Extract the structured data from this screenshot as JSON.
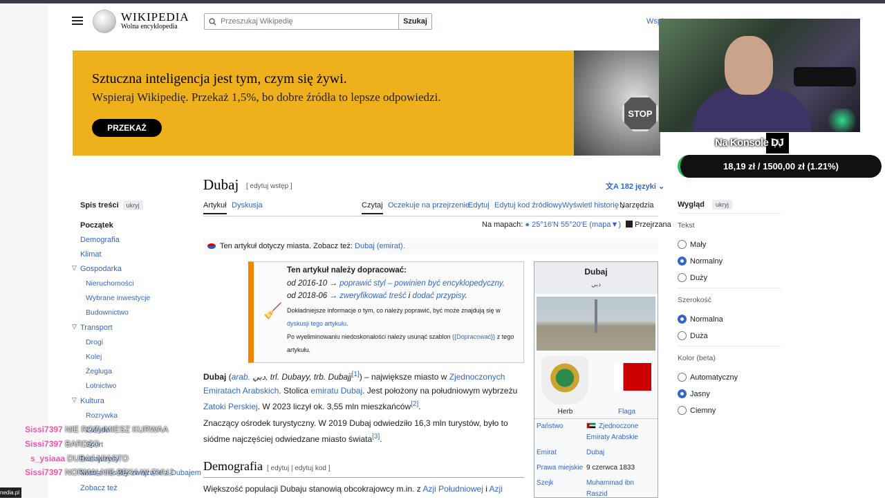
{
  "header": {
    "logo_word": "WIKIPEDIA",
    "logo_tagline": "Wolna encyklopedia",
    "search_placeholder": "Przeszukaj Wikipedię",
    "search_button": "Szukaj",
    "support_link": "Wspi"
  },
  "banner": {
    "headline": "Sztuczna inteligencja jest tym, czym się żywi.",
    "text": "Wspieraj Wikipedię. Przekaż 1,5%, bo dobre źródła to lepsze odpowiedzi.",
    "donate_button": "PRZEKAŻ",
    "stop_sign": "STOP"
  },
  "stream": {
    "channel": "Na Konsole DJ",
    "w_logo": "W",
    "donation_bar": "18,19 zł  /  1500,00 zł (1.21%)"
  },
  "article": {
    "title": "Dubaj",
    "edit_intro": "[ edytuj wstęp ]",
    "languages": "182 języki",
    "tabs": {
      "article": "Artykuł",
      "talk": "Dyskusja",
      "read": "Czytaj",
      "pending": "Oczekuje na przejrzenie",
      "edit": "Edytuj",
      "edit_source": "Edytuj kod źródłowy",
      "history": "Wyświetl historię",
      "tools": "Narzędzia"
    },
    "coords": {
      "prefix": "Na mapach:",
      "value": "25°16′N 55°20′E",
      "map_link": "(mapa▼)",
      "reviewed": "Przejrzana"
    },
    "hatnote": {
      "text": "Ten artykuł dotyczy miasta. Zobacz też: ",
      "link": "Dubaj (emirat)."
    },
    "ambox": {
      "heading": "Ten artykuł należy dopracować:",
      "line1_date": "od 2016-10 → ",
      "line1_link": "poprawić styl – powinien być encyklopedyczny,",
      "line2_date": "od 2018-06 → ",
      "line2_link": "zweryfikować treść",
      "line2_and": " i ",
      "line2_link2": "dodać przypisy",
      "line2_end": ".",
      "small1": "Dokładniejsze informacje o tym, co należy poprawić, być może znajdują się w ",
      "small1_link": "dyskusji tego artykułu",
      "small1_end": ".",
      "small2": "Po wyeliminowaniu niedoskonałości należy usunąć szablon ",
      "small2_code": "{{Dopracować}}",
      "small2_end": " z tego artykułu."
    },
    "para1": {
      "b": "Dubaj",
      "p1": " (",
      "arab": "arab. ",
      "arabic": "دبي",
      "trl": ", trl. Dubayy, trb. Dubajj",
      "ref1": "[1]",
      "p2": ") – największe miasto w ",
      "link1": "Zjednoczonych Emiratach Arabskich",
      "p3": ". Stolica ",
      "link2": "emiratu Dubaj",
      "p4": ". Jest położony na południowym wybrzeżu ",
      "link3": "Zatoki Perskiej",
      "p5": ". W 2023 liczył ok. 3,55 mln mieszkańców",
      "ref2": "[2]",
      "p6": "."
    },
    "para2": {
      "text": "Znaczący ośrodek turystyczny. W 2019 Dubaj odwiedziło 16,3 mln turystów, było to siódme najczęściej odwiedzane miasto świata",
      "ref": "[3]",
      "end": "."
    },
    "section": {
      "title": "Demografia",
      "edit": "[ edytuj | edytuj kod ]"
    },
    "para3": {
      "p1": "Większość populacji Dubaju stanowią obcokrajowcy m.in. z ",
      "link1": "Azji Południowej",
      "p2": " i ",
      "link2": "Azji"
    }
  },
  "infobox": {
    "title": "Dubaj",
    "arabic": "دبي",
    "coat_caption": "Herb",
    "flag_caption": "Flaga",
    "rows": [
      {
        "k": "Państwo",
        "v": "Zjednoczone Emiraty Arabskie"
      },
      {
        "k": "Emirat",
        "v": "Dubaj"
      },
      {
        "k": "Prawa miejskie",
        "v": "9 czerwca 1833"
      },
      {
        "k": "Szejk",
        "v": "Muhammad ibn Raszid"
      }
    ]
  },
  "toc": {
    "heading": "Spis treści",
    "hide": "ukryj",
    "items": [
      "Początek",
      "Demografia",
      "Klimat",
      "Gospodarka",
      "Nieruchomości",
      "Wybrane inwestycje",
      "Budownictwo",
      "Transport",
      "Drogi",
      "Kolej",
      "Żegluga",
      "Lotnictwo",
      "Kultura",
      "Rozrywka",
      "Zobacz też"
    ],
    "partial": [
      "Zabytki",
      "Sport",
      "Dubajczycy",
      "Dubaj nocą",
      "Miasta i osoby związane z Dubajem"
    ]
  },
  "appearance": {
    "heading": "Wygląd",
    "hide": "ukryj",
    "text_label": "Tekst",
    "text_opts": [
      "Mały",
      "Normalny",
      "Duży"
    ],
    "width_label": "Szerokość",
    "width_opts": [
      "Normalna",
      "Duża"
    ],
    "color_label": "Kolor (beta)",
    "color_opts": [
      "Automatyczny",
      "Jasny",
      "Ciemny"
    ]
  },
  "chat": [
    {
      "user": "Sissi7397",
      "msg": "NIE ROZUMIESZ KURWAA"
    },
    {
      "user": "Sissi7397",
      "msg": "BARDZO"
    },
    {
      "user": "s_ysiaaa",
      "msg": "DUBAJ MIASTO"
    },
    {
      "user": "Sissi7397",
      "msg": "NORMALNIE BEKA W CHUJ"
    }
  ],
  "overlay_tag": "nedia.pl",
  "colors": {
    "banner": "#eeb11b",
    "link": "#3366cc",
    "accent": "#f28500",
    "chat_user": "#ff4fa8",
    "donation_bar": "#111111"
  }
}
